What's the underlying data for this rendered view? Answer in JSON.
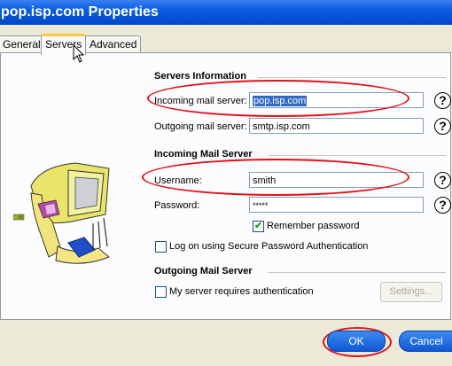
{
  "window": {
    "title": "pop.isp.com Properties"
  },
  "tabs": [
    {
      "label": "General"
    },
    {
      "label": "Servers"
    },
    {
      "label": "Advanced"
    }
  ],
  "servers_info": {
    "heading": "Servers Information",
    "incoming_label": "Incoming mail server:",
    "incoming_value": "pop.isp.com",
    "outgoing_label": "Outgoing mail server:",
    "outgoing_value": "smtp.isp.com"
  },
  "incoming_server": {
    "heading": "Incoming Mail Server",
    "username_label": "Username:",
    "username_value": "smith",
    "password_label": "Password:",
    "password_value": "*****",
    "remember_label": "Remember password",
    "spa_label": "Log on using Secure Password Authentication"
  },
  "outgoing_server": {
    "heading": "Outgoing Mail Server",
    "auth_label": "My server requires authentication",
    "settings_button": "Settings..."
  },
  "help_symbol": "?",
  "checkmark": "✔",
  "buttons": {
    "ok": "OK",
    "cancel": "Cancel"
  },
  "colors": {
    "titlebar": "#0548c8",
    "highlight_oval": "#e31018",
    "selection": "#316ac5"
  }
}
